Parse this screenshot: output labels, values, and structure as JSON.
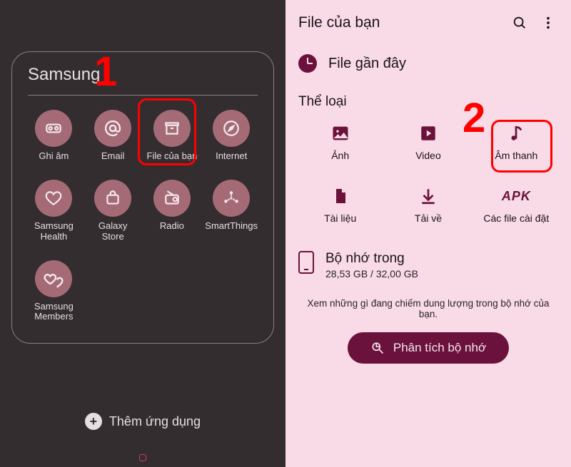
{
  "left": {
    "folder_title": "Samsung",
    "annotation_1": "1",
    "add_apps_label": "Thêm ứng dụng",
    "apps": [
      {
        "name": "ghi-am",
        "label": "Ghi âm",
        "icon": "recorder-icon"
      },
      {
        "name": "email",
        "label": "Email",
        "icon": "at-icon"
      },
      {
        "name": "file-cua-ban",
        "label": "File của bạn",
        "icon": "archive-icon"
      },
      {
        "name": "internet",
        "label": "Internet",
        "icon": "compass-icon"
      },
      {
        "name": "samsung-health",
        "label": "Samsung Health",
        "icon": "heart-icon"
      },
      {
        "name": "galaxy-store",
        "label": "Galaxy Store",
        "icon": "bag-icon"
      },
      {
        "name": "radio",
        "label": "Radio",
        "icon": "radio-icon"
      },
      {
        "name": "smartthings",
        "label": "SmartThings",
        "icon": "network-icon"
      },
      {
        "name": "samsung-members",
        "label": "Samsung Members",
        "icon": "double-heart-icon"
      }
    ]
  },
  "right": {
    "header_title": "File của bạn",
    "recent_label": "File gần đây",
    "categories_title": "Thể loại",
    "annotation_2": "2",
    "categories": [
      {
        "name": "anh",
        "label": "Ảnh",
        "icon": "image-icon"
      },
      {
        "name": "video",
        "label": "Video",
        "icon": "play-icon"
      },
      {
        "name": "am-thanh",
        "label": "Âm thanh",
        "icon": "music-icon"
      },
      {
        "name": "tai-lieu",
        "label": "Tài liệu",
        "icon": "document-icon"
      },
      {
        "name": "tai-ve",
        "label": "Tải về",
        "icon": "download-icon"
      },
      {
        "name": "apk",
        "label": "Các file cài đặt",
        "icon": "apk-text"
      }
    ],
    "storage": {
      "title": "Bộ nhớ trong",
      "subtitle": "28,53 GB / 32,00 GB"
    },
    "storage_note": "Xem những gì đang chiếm dung lượng trong bộ nhớ của bạn.",
    "analyze_label": "Phân tích bộ nhớ"
  }
}
